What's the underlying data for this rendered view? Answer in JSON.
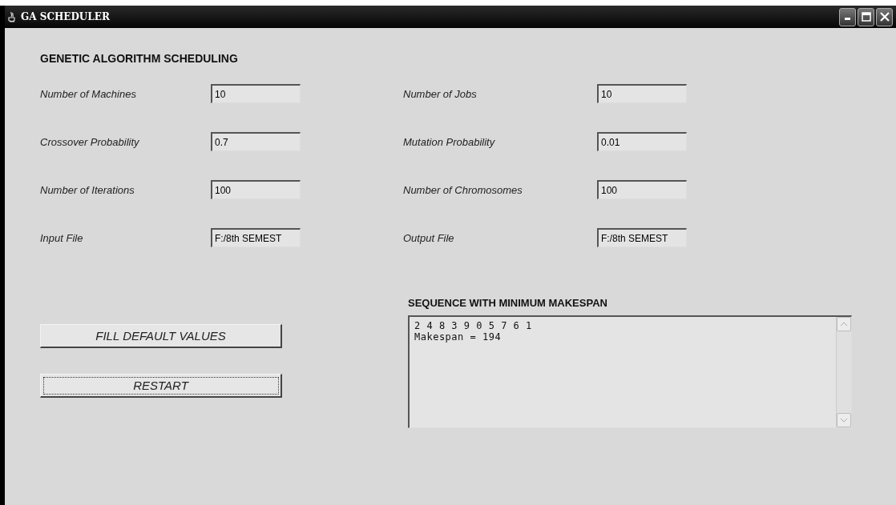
{
  "window": {
    "title": "GA SCHEDULER"
  },
  "heading": "GENETIC ALGORITHM SCHEDULING",
  "fields": [
    {
      "label": "Number of Machines",
      "value": "10"
    },
    {
      "label": "Number of Jobs",
      "value": "10"
    },
    {
      "label": "Crossover Probability",
      "value": "0.7"
    },
    {
      "label": "Mutation Probability",
      "value": "0.01"
    },
    {
      "label": "Number of Iterations",
      "value": "100"
    },
    {
      "label": "Number of Chromosomes",
      "value": "100"
    },
    {
      "label": "Input File",
      "value": "F:/8th SEMEST"
    },
    {
      "label": "Output File",
      "value": "F:/8th SEMEST"
    }
  ],
  "buttons": [
    {
      "label": "FILL DEFAULT VALUES",
      "focused": false
    },
    {
      "label": "RESTART",
      "focused": true
    }
  ],
  "output": {
    "title": "SEQUENCE WITH MINIMUM MAKESPAN",
    "lines": [
      "2 4 8 3 9 0 5 7 6 1",
      "Makespan = 194"
    ]
  }
}
